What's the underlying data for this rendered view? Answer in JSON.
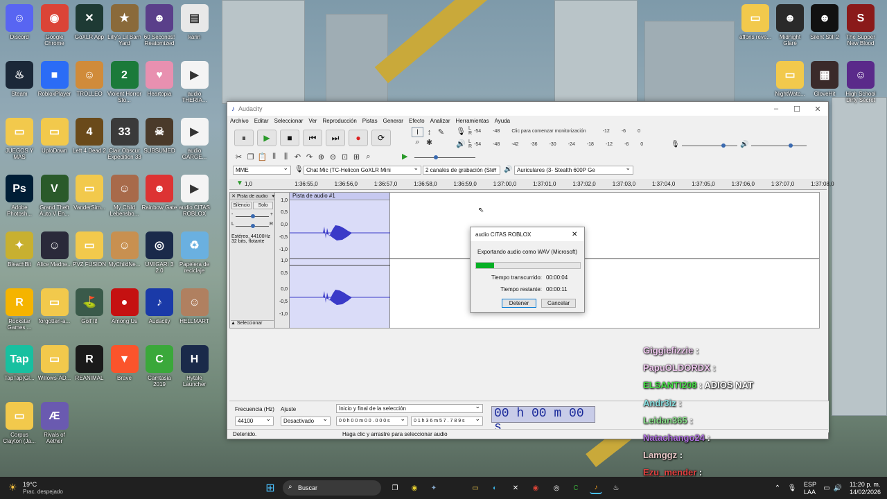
{
  "desktop": {
    "left_icons": [
      {
        "label": "Discord",
        "glyph": "☺",
        "color": "#5865F2"
      },
      {
        "label": "Google Chrome",
        "glyph": "◉",
        "color": "#db4437"
      },
      {
        "label": "GoXLR App",
        "glyph": "✕",
        "color": "#1e3a34"
      },
      {
        "label": "Lilly's Lil Barn Yard",
        "glyph": "★",
        "color": "#8a6a3a"
      },
      {
        "label": "60 Seconds! Reatomized",
        "glyph": "☻",
        "color": "#5a3f8a"
      },
      {
        "label": "karin",
        "glyph": "▤",
        "color": "#e8e8e8"
      },
      {
        "label": "Steam",
        "glyph": "♨",
        "color": "#1b2838"
      },
      {
        "label": "RobloxPlayer",
        "glyph": "■",
        "color": "#2b6cf6"
      },
      {
        "label": "TROLLEO",
        "glyph": "☺",
        "color": "#d08b3a"
      },
      {
        "label": "Violent Horror Sto...",
        "glyph": "2",
        "color": "#1b7a3a"
      },
      {
        "label": "Heartopia",
        "glyph": "♥",
        "color": "#e890b0"
      },
      {
        "label": "audio THERIA...",
        "glyph": "▶",
        "color": "#f4f4f4"
      },
      {
        "label": "JUEGOS Y MAS",
        "glyph": "▭",
        "color": "#f2c94c"
      },
      {
        "label": "UploDown",
        "glyph": "▭",
        "color": "#f2c94c"
      },
      {
        "label": "Left 4 Dead 2",
        "glyph": "4",
        "color": "#6a4a1a"
      },
      {
        "label": "Clair Obscur Expedition 33",
        "glyph": "33",
        "color": "#3a3a3a"
      },
      {
        "label": "SUBSUMED",
        "glyph": "☠",
        "color": "#4a3a2a"
      },
      {
        "label": "audio GARGE...",
        "glyph": "▶",
        "color": "#f4f4f4"
      },
      {
        "label": "Adobe Photosh...",
        "glyph": "Ps",
        "color": "#001e36"
      },
      {
        "label": "Grand Theft Auto V En...",
        "glyph": "V",
        "color": "#2a5a2a"
      },
      {
        "label": "VanderSim...",
        "glyph": "▭",
        "color": "#f2c94c"
      },
      {
        "label": "My Child Lebensbo...",
        "glyph": "☺",
        "color": "#a86a4a"
      },
      {
        "label": "Rainbow Gate",
        "glyph": "☻",
        "color": "#d33"
      },
      {
        "label": "audio CITAS ROBLOX",
        "glyph": "▶",
        "color": "#f4f4f4"
      },
      {
        "label": "BleachBit",
        "glyph": "✦",
        "color": "#c8b030"
      },
      {
        "label": "Alice Madne...",
        "glyph": "☺",
        "color": "#2a2a3a"
      },
      {
        "label": "PVZ FUSION",
        "glyph": "▭",
        "color": "#f2c94c"
      },
      {
        "label": "MyChildNe...",
        "glyph": "☺",
        "color": "#c89050"
      },
      {
        "label": "UMIGARI 3 2.0",
        "glyph": "◎",
        "color": "#1a2a4a"
      },
      {
        "label": "Papelera de reciclaje",
        "glyph": "♻",
        "color": "#6ab0e0"
      },
      {
        "label": "Rockstar Games ...",
        "glyph": "R",
        "color": "#f5b400"
      },
      {
        "label": "forgotten-a...",
        "glyph": "▭",
        "color": "#f2c94c"
      },
      {
        "label": "Golf It!",
        "glyph": "⛳",
        "color": "#3a5a4a"
      },
      {
        "label": "Among Us",
        "glyph": "●",
        "color": "#c51111"
      },
      {
        "label": "Audacity",
        "glyph": "♪",
        "color": "#1a3aa8"
      },
      {
        "label": "HELLMART",
        "glyph": "☺",
        "color": "#b08060"
      },
      {
        "label": "TapTap(Gl...",
        "glyph": "Tap",
        "color": "#18c0a0"
      },
      {
        "label": "Willows-AD...",
        "glyph": "▭",
        "color": "#f2c94c"
      },
      {
        "label": "REANIMAL",
        "glyph": "R",
        "color": "#1a1a1a"
      },
      {
        "label": "Brave",
        "glyph": "▼",
        "color": "#fb542b"
      },
      {
        "label": "Camtasia 2019",
        "glyph": "C",
        "color": "#3aa83a"
      },
      {
        "label": "Hytale Launcher",
        "glyph": "H",
        "color": "#1a2a4a"
      },
      {
        "label": "Corpus Clayton (Ja...",
        "glyph": "▭",
        "color": "#f2c94c"
      },
      {
        "label": "Rivals of Aether",
        "glyph": "Æ",
        "color": "#6a5ab0"
      }
    ],
    "right_icons": [
      {
        "label": "affons reve...",
        "glyph": "▭",
        "color": "#f2c94c"
      },
      {
        "label": "Midnight Glare",
        "glyph": "☻",
        "color": "#2a2a2a"
      },
      {
        "label": "Silent Still 2",
        "glyph": "☻",
        "color": "#111"
      },
      {
        "label": "The Supper New Blood",
        "glyph": "S",
        "color": "#8a1a1a"
      },
      {
        "label": "NightWatc...",
        "glyph": "▭",
        "color": "#f2c94c"
      },
      {
        "label": "GloveHit",
        "glyph": "▦",
        "color": "#3a2a2a"
      },
      {
        "label": "High School Dirty Secret",
        "glyph": "☺",
        "color": "#5a2a8a"
      }
    ]
  },
  "audacity": {
    "title": "Audacity",
    "menu": [
      "Archivo",
      "Editar",
      "Seleccionar",
      "Ver",
      "Reproducción",
      "Pistas",
      "Generar",
      "Efecto",
      "Analizar",
      "Herramientas",
      "Ayuda"
    ],
    "meter_hint": "Clic para comenzar monitorización",
    "meter_ticks_rec": [
      "-54",
      "-48"
    ],
    "meter_ticks_rec_tail": [
      "-12",
      "-6",
      "0"
    ],
    "meter_ticks_play": [
      "-54",
      "-48",
      "-42",
      "-36",
      "-30",
      "-24",
      "-18",
      "-12",
      "-6",
      "0"
    ],
    "host": "MME",
    "rec_device": "Chat Mic (TC-Helicon GoXLR Mini",
    "channels": "2 canales de grabación (Ster",
    "play_device": "Auriculares (3- Stealth 600P Ge",
    "ruler": [
      "1,0",
      "1:36:55,0",
      "1:36:56,0",
      "1:36:57,0",
      "1:36:58,0",
      "1:36:59,0",
      "1:37:00,0",
      "1:37:01,0",
      "1:37:02,0",
      "1:37:03,0",
      "1:37:04,0",
      "1:37:05,0",
      "1:37:06,0",
      "1:37:07,0",
      "1:37:08,0"
    ],
    "track": {
      "name": "Pista de audio",
      "clip_name": "Pista de audio #1",
      "mute": "Silencio",
      "solo": "Solo",
      "info_rate": "Estéreo, 44100Hz",
      "info_format": "32 bits, flotante",
      "select": "Seleccionar",
      "scale": [
        "1,0",
        "0,5",
        "0,0",
        "-0,5",
        "-1,0",
        "1,0",
        "0,5",
        "0,0",
        "-0,5",
        "-1,0"
      ]
    },
    "selbar": {
      "rate_label": "Frecuencia (Hz)",
      "rate_value": "44100",
      "snap_label": "Ajuste",
      "snap_value": "Desactivado",
      "sel_mode": "Inicio y final de la selección",
      "sel_start": "0 0 h 0 0 m 0 0 . 0 0 0 s",
      "sel_end": "0 1 h 3 6 m 5 7 . 7 8 9 s",
      "time": "00 h 00 m 00 s"
    },
    "status_left": "Detenido.",
    "status_right": "Haga clic y arrastre para seleccionar audio"
  },
  "dialog": {
    "title": "audio CITAS ROBLOX",
    "message": "Exportando audio como WAV (Microsoft)",
    "progress_percent": 17,
    "elapsed_label": "Tiempo transcurrido:",
    "elapsed_value": "00:00:04",
    "remaining_label": "Tiempo restante:",
    "remaining_value": "00:00:11",
    "stop": "Detener",
    "cancel": "Cancelar"
  },
  "chat": [
    {
      "name": "Giggiefizzie",
      "text": "",
      "color": "#f0c8f0"
    },
    {
      "name": "PapuOLDORDX",
      "text": "",
      "color": "#f0c8f0"
    },
    {
      "name": "ELSANTI208",
      "text": "ADIOS NAT",
      "color": "#44dd44"
    },
    {
      "name": "Andr3iz",
      "text": "",
      "color": "#88e0e0"
    },
    {
      "name": "Leidan365",
      "text": "",
      "color": "#88e088"
    },
    {
      "name": "Natachango24",
      "text": "",
      "color": "#b070e0"
    },
    {
      "name": "Lamggz",
      "text": "",
      "color": "#e8c8c8"
    },
    {
      "name": "Ezu_mender",
      "text": "",
      "color": "#e04040"
    }
  ],
  "taskbar": {
    "temp": "19°C",
    "weather": "Prac. despejado",
    "search": "Buscar",
    "lang1": "ESP",
    "lang2": "LAA",
    "time": "11:20 p. m.",
    "date": "14/02/2026"
  }
}
